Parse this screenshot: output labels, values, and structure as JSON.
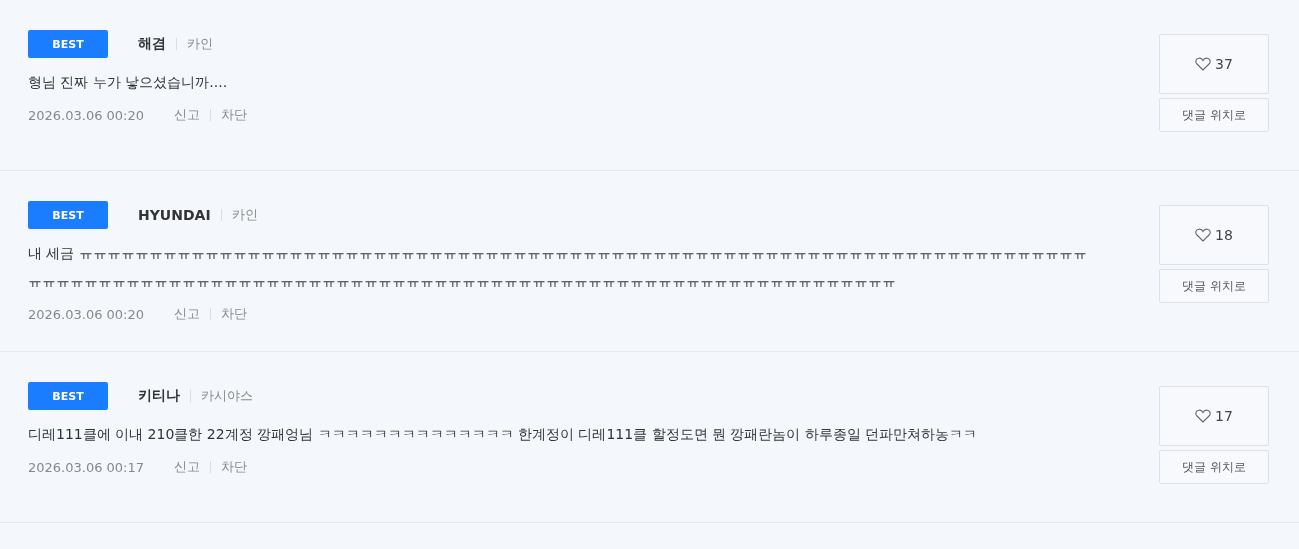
{
  "comments": [
    {
      "badge": "BEST",
      "author": "해겸",
      "server": "카인",
      "text": "형님 진짜 누가 낳으셨습니까....",
      "date": "2026.03.06 00:20",
      "report": "신고",
      "block": "차단",
      "likes": "37",
      "jump": "댓글 위치로"
    },
    {
      "badge": "BEST",
      "author": "HYUNDAI",
      "server": "카인",
      "text": "내 세금 ㅠㅠㅠㅠㅠㅠㅠㅠㅠㅠㅠㅠㅠㅠㅠㅠㅠㅠㅠㅠㅠㅠㅠㅠㅠㅠㅠㅠㅠㅠㅠㅠㅠㅠㅠㅠㅠㅠㅠㅠㅠㅠㅠㅠㅠㅠㅠㅠㅠㅠㅠㅠㅠㅠㅠㅠㅠㅠㅠㅠㅠㅠㅠㅠㅠㅠㅠㅠㅠㅠㅠㅠㅠㅠㅠㅠㅠㅠㅠㅠㅠㅠㅠㅠㅠㅠㅠㅠㅠㅠㅠㅠㅠㅠㅠㅠㅠㅠㅠㅠㅠㅠㅠㅠㅠㅠㅠㅠㅠㅠㅠㅠㅠㅠㅠㅠㅠㅠㅠㅠㅠㅠㅠㅠㅠㅠㅠㅠㅠㅠㅠㅠㅠㅠ",
      "date": "2026.03.06 00:20",
      "report": "신고",
      "block": "차단",
      "likes": "18",
      "jump": "댓글 위치로"
    },
    {
      "badge": "BEST",
      "author": "키티나",
      "server": "카시야스",
      "text": "디레111클에 이내 210클한  22계정 깡패엉님 ㅋㅋㅋㅋㅋㅋㅋㅋㅋㅋㅋㅋㅋㅋ 한계정이 디레111클 할정도면 뭔 깡패란놈이 하루종일 던파만쳐하농ㅋㅋ",
      "date": "2026.03.06 00:17",
      "report": "신고",
      "block": "차단",
      "likes": "17",
      "jump": "댓글 위치로"
    }
  ]
}
